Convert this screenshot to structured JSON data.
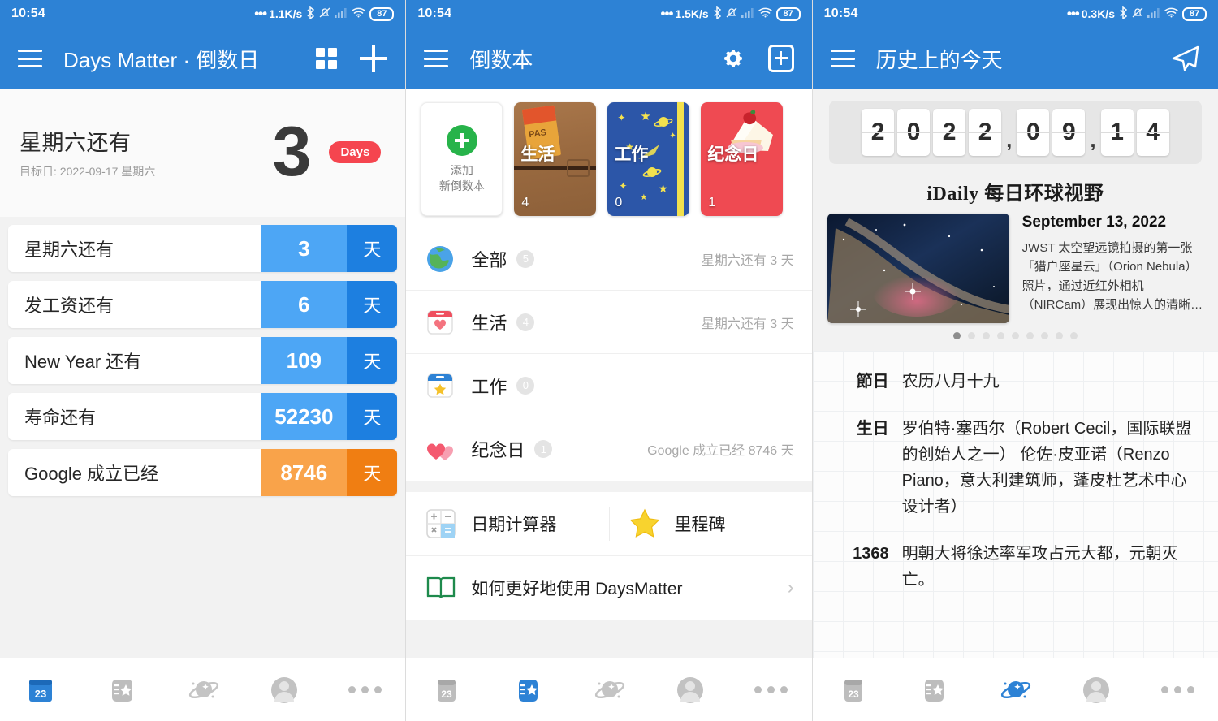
{
  "status_bar": {
    "time": "10:54",
    "battery": "87",
    "net_speed_1": "1.1K/s",
    "net_speed_2": "1.5K/s",
    "net_speed_3": "0.3K/s",
    "icons": [
      "dots-icon",
      "bluetooth-icon",
      "bell-muted-icon",
      "signal-icon",
      "wifi-icon",
      "battery-icon"
    ]
  },
  "panel1": {
    "appbar": {
      "menu_icon": "hamburger-icon",
      "title": "Days Matter · 倒数日",
      "grid_icon": "grid-view-icon",
      "plus_icon": "plus-icon"
    },
    "hero": {
      "title": "星期六还有",
      "subtitle": "目标日: 2022-09-17 星期六",
      "number": "3",
      "badge": "Days"
    },
    "countdowns": [
      {
        "name": "星期六还有",
        "value": "3",
        "unit": "天",
        "color": "blue"
      },
      {
        "name": "发工资还有",
        "value": "6",
        "unit": "天",
        "color": "blue"
      },
      {
        "name": "New Year 还有",
        "value": "109",
        "unit": "天",
        "color": "blue"
      },
      {
        "name": "寿命还有",
        "value": "52230",
        "unit": "天",
        "color": "blue"
      },
      {
        "name": "Google 成立已经",
        "value": "8746",
        "unit": "天",
        "color": "orange"
      }
    ],
    "nav_active": "calendar"
  },
  "panel2": {
    "appbar": {
      "menu_icon": "hamburger-icon",
      "title": "倒数本",
      "gear_icon": "gear-icon",
      "add_book_icon": "add-box-icon"
    },
    "books": [
      {
        "type": "add",
        "label_line1": "添加",
        "label_line2": "新倒数本"
      },
      {
        "type": "life",
        "title": "生活",
        "count": "4"
      },
      {
        "type": "work",
        "title": "工作",
        "count": "0"
      },
      {
        "type": "anniversary",
        "title": "纪念日",
        "count": "1"
      }
    ],
    "categories": [
      {
        "icon": "globe-icon",
        "name": "全部",
        "badge": "5",
        "note": "星期六还有 3 天"
      },
      {
        "icon": "calendar-heart-icon",
        "name": "生活",
        "badge": "4",
        "note": "星期六还有 3 天"
      },
      {
        "icon": "calendar-star-icon",
        "name": "工作",
        "badge": "0",
        "note": ""
      },
      {
        "icon": "hearts-icon",
        "name": "纪念日",
        "badge": "1",
        "note": "Google 成立已经 8746 天"
      }
    ],
    "tools": [
      {
        "icon": "calculator-icon",
        "name": "日期计算器"
      },
      {
        "icon": "star-icon",
        "name": "里程碑"
      }
    ],
    "guide": {
      "icon": "book-icon",
      "name": "如何更好地使用 DaysMatter",
      "chevron": "chevron-right-icon"
    },
    "nav_active": "notebook"
  },
  "panel3": {
    "appbar": {
      "menu_icon": "hamburger-icon",
      "title": "历史上的今天",
      "send_icon": "send-icon"
    },
    "flip_date": {
      "digits": [
        "2",
        "0",
        "2",
        "2",
        ",",
        "0",
        "9",
        ",",
        "1",
        "4"
      ],
      "year": "2022",
      "month": "09",
      "day": "14"
    },
    "idaily": {
      "title": "iDaily 每日环球视野",
      "date": "September 13, 2022",
      "description": "JWST 太空望远镜拍摄的第一张「猎户座星云」（Orion Nebula）照片，通过近红外相机（NIRCam）展现出惊人的清晰…",
      "dot_count": 9,
      "active_dot": 0
    },
    "history": [
      {
        "label": "節日",
        "text": "农历八月十九"
      },
      {
        "label": "生日",
        "text": "罗伯特·塞西尔（Robert Cecil，国际联盟的创始人之一）\n伦佐·皮亚诺（Renzo Piano，意大利建筑师，蓬皮杜艺术中心设计者）"
      },
      {
        "label": "1368",
        "text": "明朝大将徐达率军攻占元大都，元朝灭亡。"
      }
    ],
    "nav_active": "planet"
  },
  "bottom_nav": {
    "items": [
      {
        "icon": "calendar-23-icon",
        "key": "calendar"
      },
      {
        "icon": "notebook-star-icon",
        "key": "notebook"
      },
      {
        "icon": "planet-icon",
        "key": "planet"
      },
      {
        "icon": "avatar-icon",
        "key": "avatar"
      },
      {
        "icon": "more-dots-icon",
        "key": "more"
      }
    ]
  },
  "colors": {
    "header_blue": "#2d82d5",
    "accent_blue_light": "#4da6f5",
    "accent_blue_dark": "#1d7fe0",
    "accent_orange_light": "#f9a34a",
    "accent_orange_dark": "#f07e12",
    "badge_red": "#f5454f",
    "nav_inactive": "#bdbdbd",
    "nav_active": "#2d82d5"
  }
}
